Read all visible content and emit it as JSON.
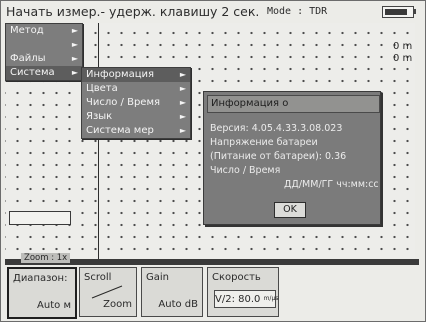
{
  "title": "Начать измер.- удерж. клавишу 2 сек.",
  "mode": "Mode : TDR",
  "battery_level": 0.85,
  "readouts": [
    "0 m",
    "0 m"
  ],
  "main_menu": [
    {
      "label": "Метод",
      "has_submenu": true
    },
    {
      "label": "",
      "has_submenu": true
    },
    {
      "label": "Файлы",
      "has_submenu": true
    },
    {
      "label": "Система",
      "has_submenu": true
    }
  ],
  "system_menu": [
    {
      "label": "Информация",
      "has_submenu": true
    },
    {
      "label": "Цвета",
      "has_submenu": true
    },
    {
      "label": "Число / Время",
      "has_submenu": true
    },
    {
      "label": "Язык",
      "has_submenu": true
    },
    {
      "label": "Система мер",
      "has_submenu": true
    }
  ],
  "arrow_glyph": "►",
  "info_dialog": {
    "title": "Информация о",
    "lines": [
      "Версия: 4.05.4.33.3.08.023",
      "Напряжение батареи",
      "(Питание от батареи): 0.36",
      "Число / Время",
      "ДД/ММ/ГГ чч:мм:сс"
    ],
    "ok_label": "OK"
  },
  "zoom_label": "Zoom : 1x",
  "softkeys": [
    {
      "top": "Диапазон:",
      "bottom": "Auto м"
    },
    {
      "top": "Scroll",
      "bottom": "Zoom"
    },
    {
      "top": "Gain",
      "bottom": "Auto dB"
    },
    {
      "top": "Скорость",
      "value": "V/2: 80.0",
      "unit": "m/µs"
    }
  ]
}
